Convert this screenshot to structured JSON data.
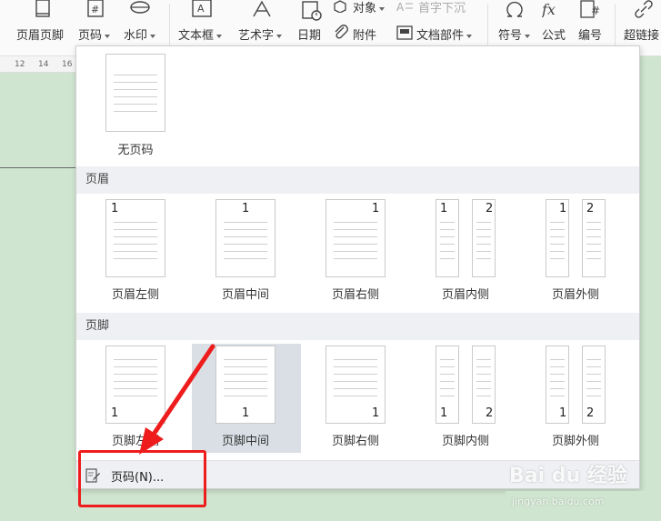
{
  "ribbon": {
    "header_footer": "页眉页脚",
    "page_number": "页码",
    "watermark": "水印",
    "textbox": "文本框",
    "wordart": "艺术字",
    "date": "日期",
    "object": "对象",
    "dropcap": "首字下沉",
    "attachment": "附件",
    "doc_parts": "文档部件",
    "symbol": "符号",
    "formula": "公式",
    "numbering": "编号",
    "hyperlink": "超链接"
  },
  "ruler": {
    "ticks": [
      "12",
      "14",
      "16"
    ]
  },
  "panel": {
    "no_page_number": "无页码",
    "header_section": "页眉",
    "footer_section": "页脚",
    "header_items": [
      {
        "label": "页眉左侧",
        "num": "1"
      },
      {
        "label": "页眉中间",
        "num": "1"
      },
      {
        "label": "页眉右侧",
        "num": "1"
      },
      {
        "label": "页眉内侧",
        "num_left": "1",
        "num_right": "2"
      },
      {
        "label": "页眉外侧",
        "num_left": "1",
        "num_right": "2"
      }
    ],
    "footer_items": [
      {
        "label": "页脚左侧",
        "num": "1"
      },
      {
        "label": "页脚中间",
        "num": "1"
      },
      {
        "label": "页脚右侧",
        "num": "1"
      },
      {
        "label": "页脚内侧",
        "num_left": "1",
        "num_right": "2"
      },
      {
        "label": "页脚外侧",
        "num_left": "1",
        "num_right": "2"
      }
    ],
    "page_number_dialog": "页码(N)..."
  },
  "watermark": {
    "brand": "Bai du 经验",
    "site": "jingyan.baidu.com"
  },
  "colors": {
    "annotation": "#ee1c1c",
    "section_bg": "#eef0f3",
    "hover": "#d9dfe5",
    "doc_bg": "#cfe5cf"
  }
}
